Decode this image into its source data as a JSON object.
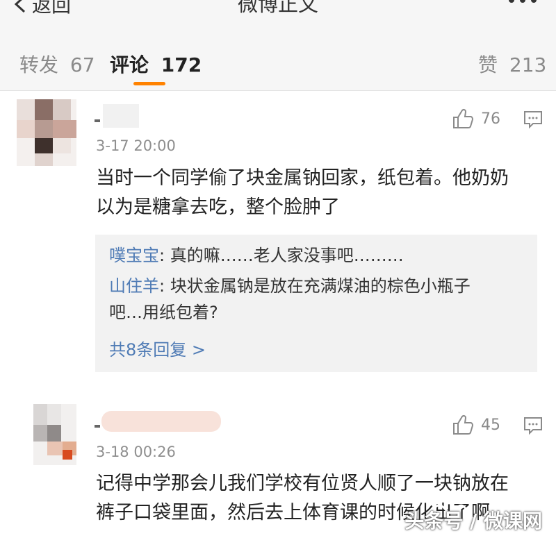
{
  "header": {
    "back_label": "返回",
    "title": "微博正文"
  },
  "tabs": [
    {
      "label": "转发",
      "count": "67"
    },
    {
      "label": "评论",
      "count": "172"
    },
    {
      "label": "赞",
      "count": "213"
    }
  ],
  "comments": [
    {
      "time": "3-17 20:00",
      "likes": "76",
      "lines": [
        "当时一个同学偷了块金属钠回家，纸包着。他奶奶",
        "以为是糖拿去吃，整个脸肿了"
      ],
      "replies": [
        {
          "user": "噗宝宝",
          "text": ": 真的嘛……老人家没事吧………"
        },
        {
          "user": "山住羊",
          "text": ": 块状金属钠是放在充满煤油的棕色小瓶子",
          "cont": "吧…用纸包着?"
        }
      ],
      "more_replies": "共8条回复 >"
    },
    {
      "time": "3-18 00:26",
      "likes": "45",
      "lines": [
        "记得中学那会儿我们学校有位贤人顺了一块钠放在",
        "裤子口袋里面，然后去上体育课的时候化出了啊"
      ]
    }
  ],
  "watermark": "头条号 / 微课网",
  "colors": {
    "accent": "#ff8200",
    "link": "#4f7bb5"
  }
}
